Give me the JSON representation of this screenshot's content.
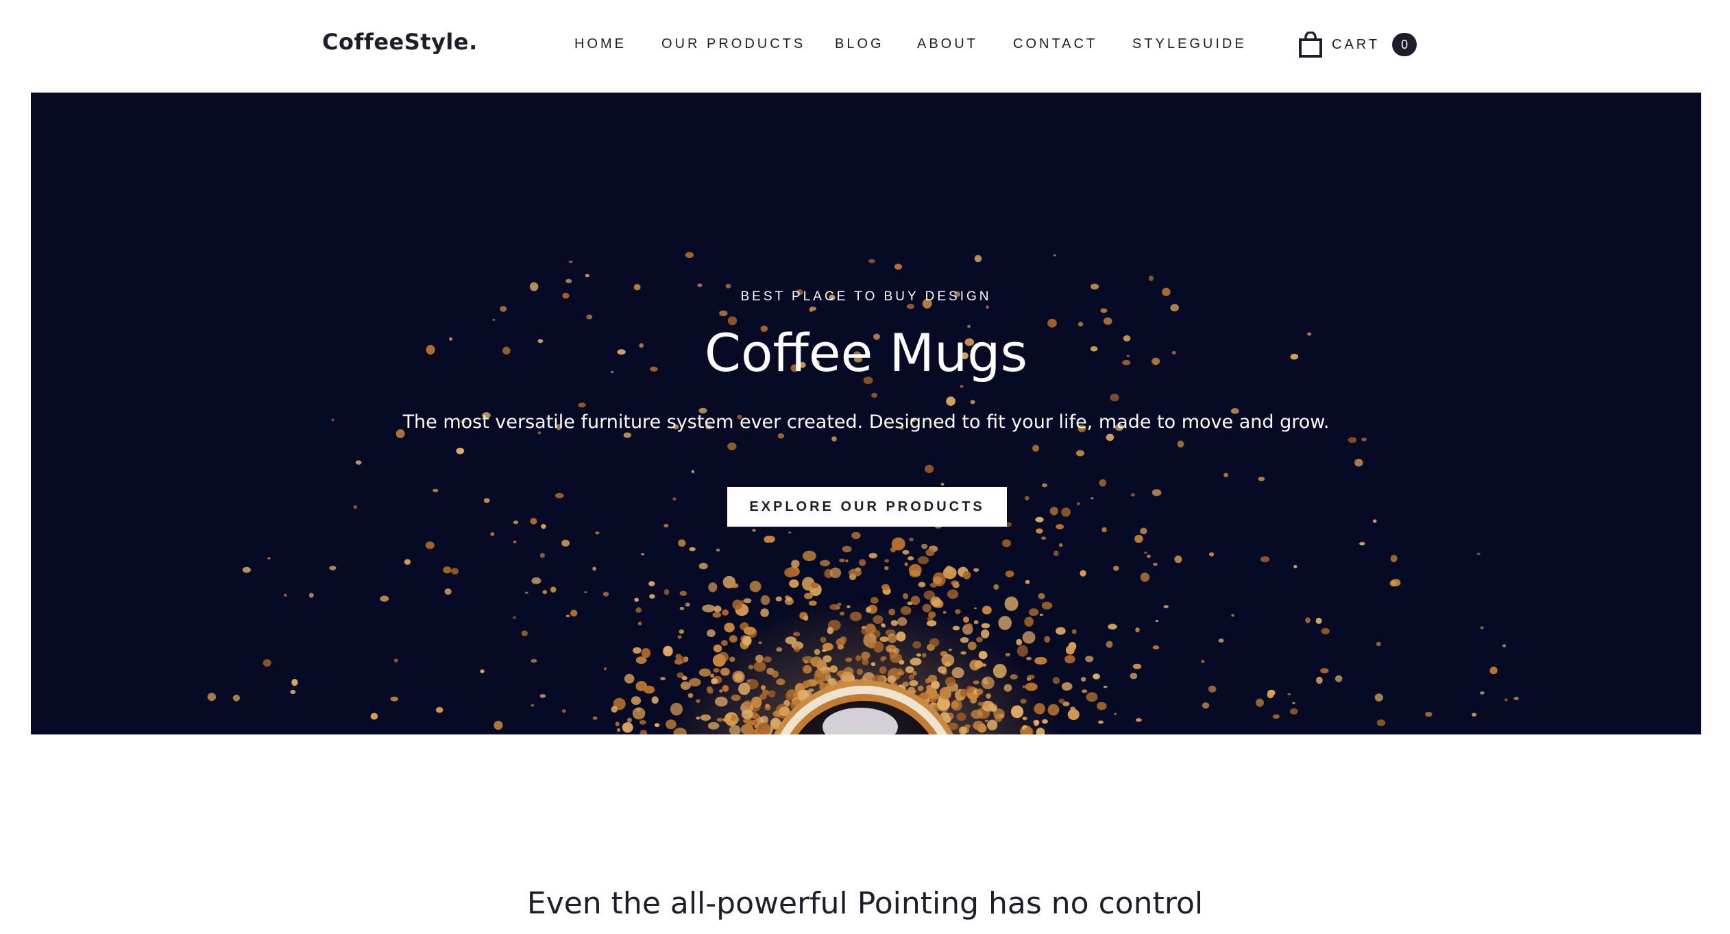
{
  "brand": {
    "logo": "CoffeeStyle."
  },
  "nav": {
    "items": [
      {
        "label": "HOME"
      },
      {
        "label": "OUR PRODUCTS"
      },
      {
        "label": "BLOG"
      },
      {
        "label": "ABOUT"
      },
      {
        "label": "CONTACT"
      },
      {
        "label": "STYLEGUIDE"
      }
    ]
  },
  "cart": {
    "label": "CART",
    "count": "0",
    "icon": "shopping-bag-icon"
  },
  "hero": {
    "eyebrow": "BEST PLACE TO BUY DESIGN",
    "title": "Coffee Mugs",
    "description": "The most versatile furniture system ever created. Designed to fit your life, made to move and grow.",
    "button_label": "EXPLORE OUR PRODUCTS"
  },
  "section": {
    "heading": "Even the all-powerful Pointing has no control"
  },
  "colors": {
    "text": "#1d1d2b",
    "hero_bg": "#070a24",
    "accent": "#c8873e"
  }
}
